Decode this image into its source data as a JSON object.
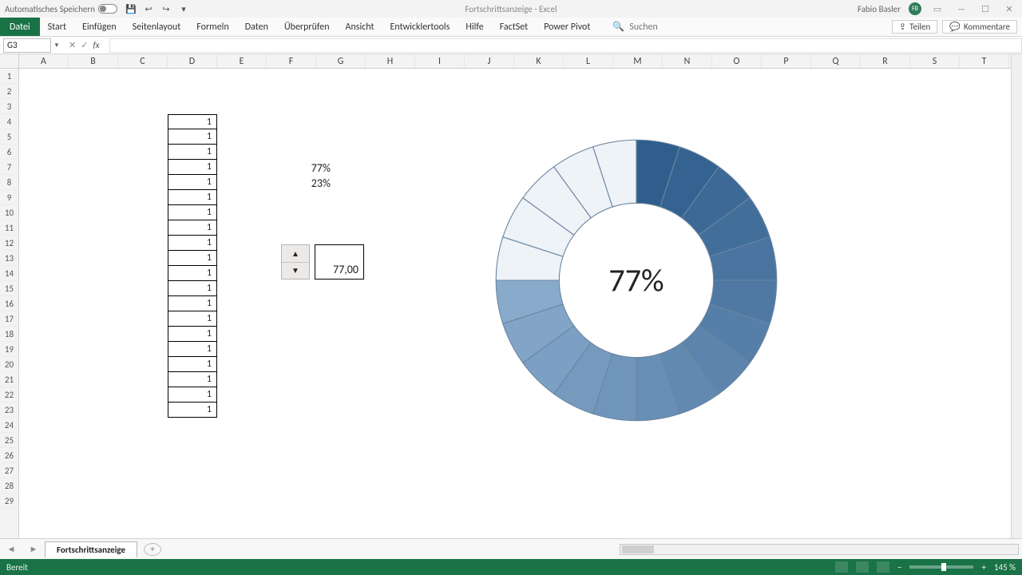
{
  "title": {
    "autosave_label": "Automatisches Speichern",
    "doc": "Fortschrittsanzeige",
    "app": "Excel",
    "user": "Fabio Basler",
    "avatar": "FB"
  },
  "qat": {
    "save": "💾",
    "undo": "↩",
    "redo": "↪",
    "more": "▾"
  },
  "ribbon": {
    "file": "Datei",
    "tabs": [
      "Start",
      "Einfügen",
      "Seitenlayout",
      "Formeln",
      "Daten",
      "Überprüfen",
      "Ansicht",
      "Entwicklertools",
      "Hilfe",
      "FactSet",
      "Power Pivot"
    ],
    "search_placeholder": "Suchen",
    "share": "Teilen",
    "comments": "Kommentare"
  },
  "formula_bar": {
    "namebox": "G3",
    "fx": "fx"
  },
  "grid": {
    "columns": [
      "A",
      "B",
      "C",
      "D",
      "E",
      "F",
      "G",
      "H",
      "I",
      "J",
      "K",
      "L",
      "M",
      "N",
      "O",
      "P",
      "Q",
      "R",
      "S",
      "T"
    ],
    "rows": [
      "1",
      "2",
      "3",
      "4",
      "5",
      "6",
      "7",
      "8",
      "9",
      "10",
      "11",
      "12",
      "13",
      "14",
      "15",
      "16",
      "17",
      "18",
      "19",
      "20",
      "21",
      "22",
      "23",
      "24",
      "25",
      "26",
      "27",
      "28",
      "29"
    ],
    "dvalues": [
      "1",
      "1",
      "1",
      "1",
      "1",
      "1",
      "1",
      "1",
      "1",
      "1",
      "1",
      "1",
      "1",
      "1",
      "1",
      "1",
      "1",
      "1",
      "1",
      "1"
    ],
    "pct1": "77%",
    "pct2": "23%",
    "spin_value": "77,00"
  },
  "chart_data": {
    "type": "pie",
    "title": "",
    "center_label": "77%",
    "segments": 20,
    "filled_fraction": 0.77,
    "hole_ratio": 0.55,
    "values": [
      1,
      1,
      1,
      1,
      1,
      1,
      1,
      1,
      1,
      1,
      1,
      1,
      1,
      1,
      1,
      1,
      1,
      1,
      1,
      1
    ],
    "fill_color_start": "#2f5e8d",
    "fill_color_end": "#a8c6e2",
    "empty_color": "#eef3f8"
  },
  "sheettab": {
    "name": "Fortschrittsanzeige"
  },
  "status": {
    "ready": "Bereit",
    "zoom": "145 %"
  }
}
